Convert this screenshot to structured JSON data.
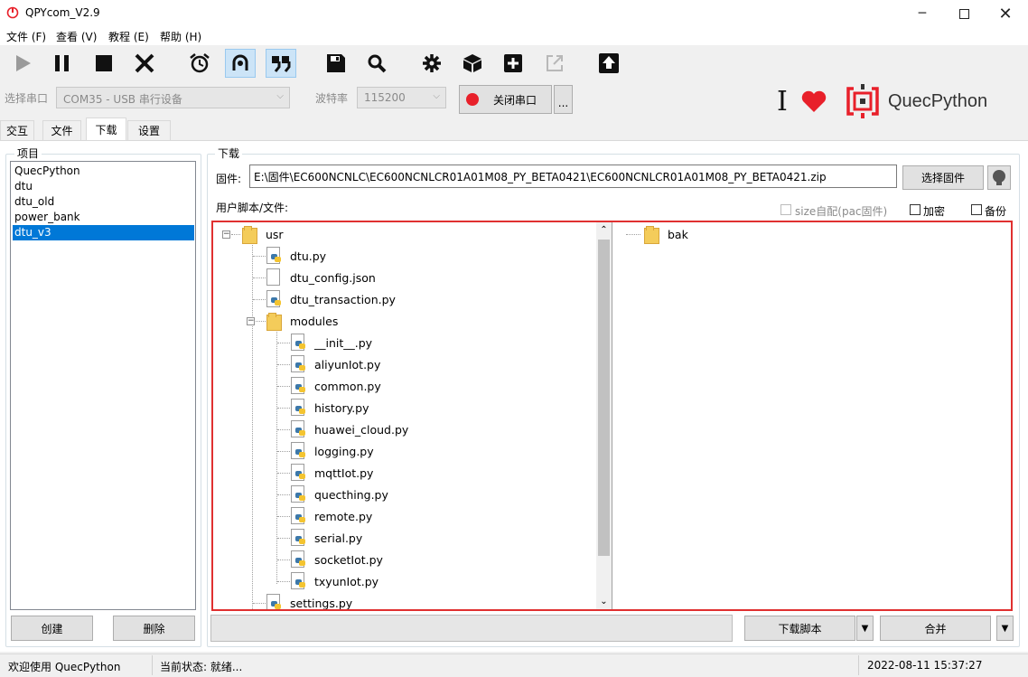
{
  "window": {
    "title": "QPYcom_V2.9"
  },
  "menu": [
    "文件 (F)",
    "查看 (V)",
    "教程 (E)",
    "帮助 (H)"
  ],
  "toolbar": {
    "icons": [
      "play-icon",
      "pause-icon",
      "stop-icon",
      "close-x-icon",
      "alarm-clock-icon",
      "loop-icon",
      "quote-icon",
      "save-icon",
      "search-icon",
      "gear-icon",
      "package-icon",
      "plus-icon",
      "export-icon",
      "upload-icon"
    ]
  },
  "serial": {
    "port_label": "选择串口",
    "port_value": "COM35 - USB 串行设备",
    "baud_label": "波特率",
    "baud_value": "115200",
    "close_port_label": "关闭串口",
    "more_label": "..."
  },
  "brand": {
    "name": "QuecPython",
    "cursor_glyph": "I",
    "accent": "#e8202a"
  },
  "tabs": [
    {
      "label": "交互",
      "selected": false
    },
    {
      "label": "文件",
      "selected": false
    },
    {
      "label": "下载",
      "selected": true
    },
    {
      "label": "设置",
      "selected": false
    }
  ],
  "projects": {
    "title": "项目",
    "items": [
      "QuecPython",
      "dtu",
      "dtu_old",
      "power_bank",
      "dtu_v3"
    ],
    "selected": "dtu_v3",
    "create_label": "创建",
    "delete_label": "删除"
  },
  "download": {
    "title": "下载",
    "firmware_label": "固件:",
    "firmware_path": "E:\\固件\\EC600NCNLC\\EC600NCNLCR01A01M08_PY_BETA0421\\EC600NCNLCR01A01M08_PY_BETA0421.zip",
    "select_firmware_label": "选择固件",
    "user_files_label": "用户脚本/文件:",
    "size_auto_label": "size自配(pac固件)",
    "encrypt_label": "加密",
    "backup_label": "备份",
    "tree": {
      "root": "usr",
      "files": [
        "dtu.py",
        "dtu_config.json",
        "dtu_transaction.py"
      ],
      "modules_folder": "modules",
      "module_files": [
        "__init__.py",
        "aliyunIot.py",
        "common.py",
        "history.py",
        "huawei_cloud.py",
        "logging.py",
        "mqttIot.py",
        "quecthing.py",
        "remote.py",
        "serial.py",
        "socketIot.py",
        "txyunIot.py"
      ],
      "trailing_file": "settings.py"
    },
    "right_tree": {
      "folder": "bak"
    },
    "download_script_label": "下载脚本",
    "merge_label": "合并"
  },
  "status": {
    "welcome": "欢迎使用 QuecPython",
    "state": "当前状态: 就绪...",
    "datetime": "2022-08-11 15:37:27"
  }
}
